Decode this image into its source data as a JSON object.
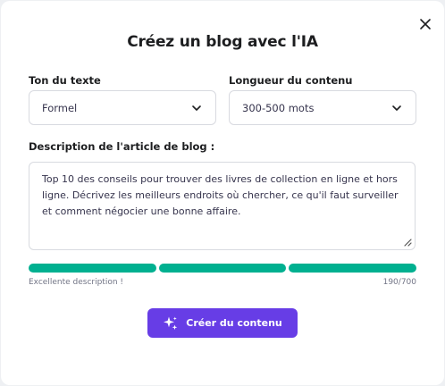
{
  "dialog": {
    "title": "Créez un blog avec l'IA",
    "close_icon": "close-icon"
  },
  "tone": {
    "label": "Ton du texte",
    "selected": "Formel"
  },
  "length": {
    "label": "Longueur du contenu",
    "selected": "300-500 mots"
  },
  "description": {
    "label": "Description de l'article de blog :",
    "value": "Top 10 des conseils pour trouver des livres de collection en ligne et hors ligne. Décrivez les meilleurs endroits où chercher, ce qu'il faut surveiller et comment négocier une bonne affaire.",
    "quality_text": "Excellente description !",
    "counter": "190/700",
    "quality_segments_filled": 3,
    "quality_segments_total": 3
  },
  "cta": {
    "label": "Créer du contenu",
    "icon": "sparkles-icon"
  },
  "colors": {
    "accent": "#673de6",
    "progress": "#00b090",
    "text": "#1d1e20"
  }
}
